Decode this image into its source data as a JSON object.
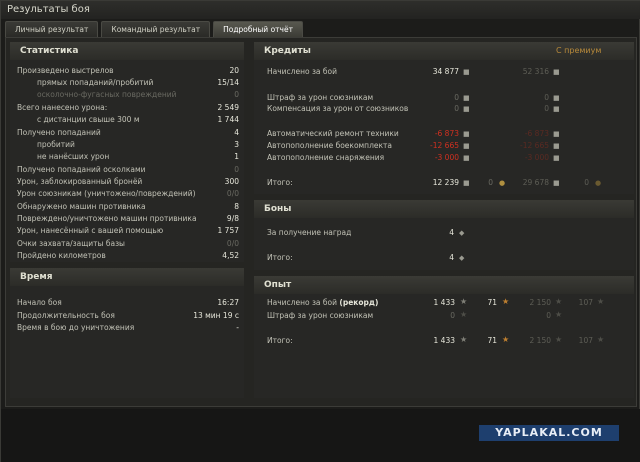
{
  "window": {
    "title": "Результаты боя"
  },
  "tabs": [
    "Личный результат",
    "Командный результат",
    "Подробный отчёт"
  ],
  "stats": {
    "title": "Статистика",
    "rows": [
      {
        "label": "Произведено выстрелов",
        "value": "20"
      },
      {
        "label": "прямых попаданий/пробитий",
        "value": "15/14"
      },
      {
        "label": "осколочно-фугасных повреждений",
        "value": "0"
      },
      {
        "label": "Всего нанесено урона:",
        "value": "2 549"
      },
      {
        "label": "с дистанции свыше 300 м",
        "value": "1 744"
      },
      {
        "label": "Получено попаданий",
        "value": "4"
      },
      {
        "label": "пробитий",
        "value": "3"
      },
      {
        "label": "не нанёсших урон",
        "value": "1"
      },
      {
        "label": "Получено попаданий осколками",
        "value": "0"
      },
      {
        "label": "Урон, заблокированный бронёй",
        "value": "300"
      },
      {
        "label": "Урон союзникам (уничтожено/повреждений)",
        "value": "0/0"
      },
      {
        "label": "Обнаружено машин противника",
        "value": "8"
      },
      {
        "label": "Повреждено/уничтожено машин противника",
        "value": "9/8"
      },
      {
        "label": "Урон, нанесённый с вашей помощью",
        "value": "1 757"
      },
      {
        "label": "Очки захвата/защиты базы",
        "value": "0/0"
      },
      {
        "label": "Пройдено километров",
        "value": "4,52"
      }
    ]
  },
  "time": {
    "title": "Время",
    "rows": [
      {
        "label": "Начало боя",
        "value": "16:27"
      },
      {
        "label": "Продолжительность боя",
        "value": "13 мин 19 с"
      },
      {
        "label": "Время в бою до уничтожения",
        "value": "-"
      }
    ]
  },
  "credits": {
    "title": "Кредиты",
    "premium": "С премиум",
    "rows": [
      {
        "label": "Начислено за бой",
        "v1": "34 877",
        "v2": "52 316"
      },
      {
        "label": "Штраф за урон союзникам",
        "v1": "0",
        "v2": "0"
      },
      {
        "label": "Компенсация за урон от союзников",
        "v1": "0",
        "v2": "0"
      },
      {
        "label": "Автоматический ремонт техники",
        "v1": "-6 873",
        "v2": "-6 873"
      },
      {
        "label": "Автопополнение боекомплекта",
        "v1": "-12 665",
        "v2": "-12 665"
      },
      {
        "label": "Автопополнение снаряжения",
        "v1": "-3 000",
        "v2": "-3 000"
      },
      {
        "label": "Итого:",
        "v1": "12 239",
        "v1b": "0",
        "v2": "29 678",
        "v2b": "0"
      }
    ]
  },
  "bonds": {
    "title": "Боны",
    "rows": [
      {
        "label": "За получение наград",
        "value": "4"
      },
      {
        "label": "Итого:",
        "value": "4"
      }
    ]
  },
  "exp": {
    "title": "Опыт",
    "rows": [
      {
        "label": "Начислено за бой",
        "label_b": "(рекорд)",
        "v1": "1 433",
        "v1b": "71",
        "v2": "2 150",
        "v2b": "107"
      },
      {
        "label": "Штраф за урон союзникам",
        "v1": "0",
        "v2": "0"
      },
      {
        "label": "Итого:",
        "v1": "1 433",
        "v1b": "71",
        "v2": "2 150",
        "v2b": "107"
      }
    ]
  },
  "watermark": "YAPLAKAL.COM"
}
